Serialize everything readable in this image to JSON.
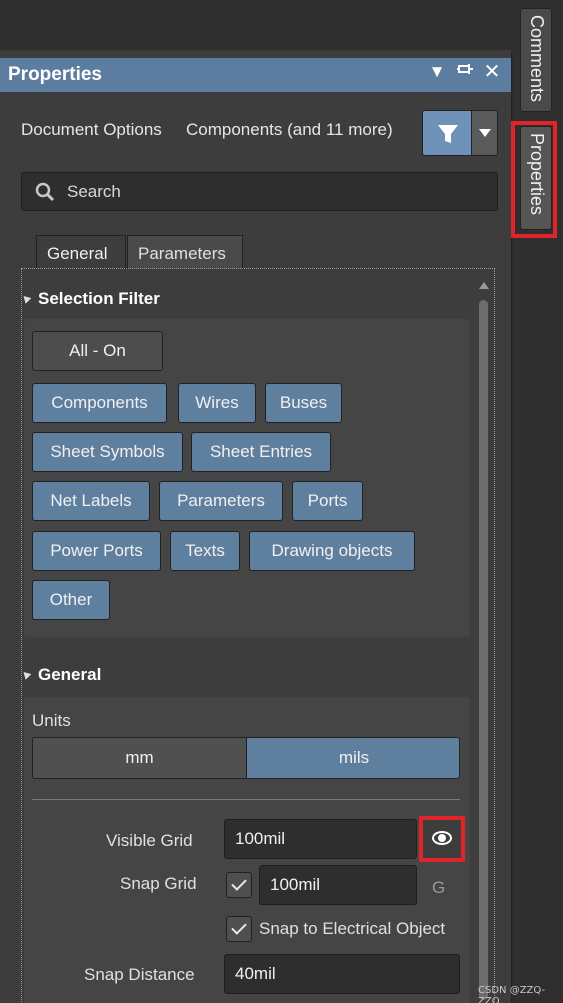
{
  "panel": {
    "title": "Properties",
    "document_options": "Document Options",
    "selection_summary": "Components (and 11 more)",
    "search_placeholder": "Search",
    "tabs": [
      "General",
      "Parameters"
    ]
  },
  "selection_filter": {
    "heading": "Selection Filter",
    "all_on": "All - On",
    "buttons": [
      "Components",
      "Wires",
      "Buses",
      "Sheet Symbols",
      "Sheet Entries",
      "Net Labels",
      "Parameters",
      "Ports",
      "Power Ports",
      "Texts",
      "Drawing objects",
      "Other"
    ]
  },
  "general": {
    "heading": "General",
    "units_label": "Units",
    "units": [
      "mm",
      "mils"
    ],
    "selected_unit": "mils",
    "visible_grid_label": "Visible Grid",
    "visible_grid_value": "100mil",
    "snap_grid_label": "Snap Grid",
    "snap_grid_value": "100mil",
    "snap_grid_shortcut": "G",
    "snap_electrical_label": "Snap to Electrical Object",
    "snap_distance_label": "Snap Distance",
    "snap_distance_value": "40mil"
  },
  "side_tabs": [
    "Comments",
    "Properties"
  ],
  "watermark": "CSDN @ZZQ-ZZQ",
  "colors": {
    "accent": "#5f7f9f",
    "titlebar": "#5c7d9f",
    "highlight_box": "#e0242a"
  },
  "icons": [
    "filter-icon",
    "dropdown-arrow-icon",
    "search-icon",
    "pin-icon",
    "close-icon",
    "collapse-triangle-icon",
    "checkmark-icon",
    "eye-icon"
  ]
}
